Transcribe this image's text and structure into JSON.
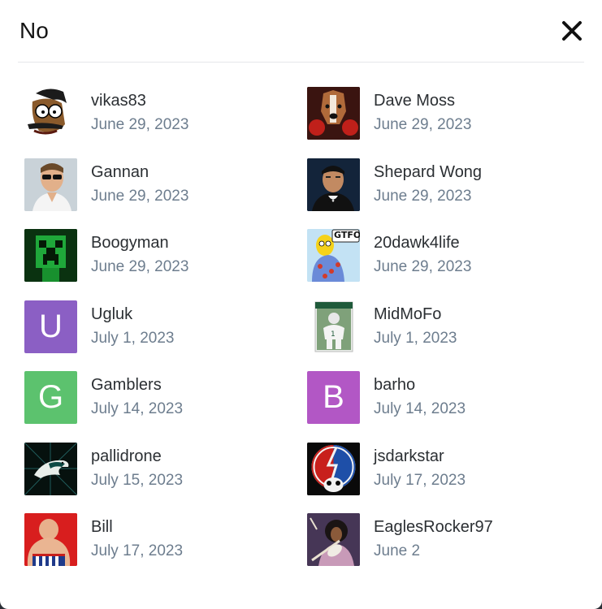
{
  "modal": {
    "title": "No",
    "close_icon": "close-icon"
  },
  "users": [
    {
      "name": "vikas83",
      "date": "June 29, 2023",
      "avatar": "cartoon-face-avatar"
    },
    {
      "name": "Dave Moss",
      "date": "June 29, 2023",
      "avatar": "boxer-dog-avatar"
    },
    {
      "name": "Gannan",
      "date": "June 29, 2023",
      "avatar": "sunglasses-man-avatar"
    },
    {
      "name": "Shepard Wong",
      "date": "June 29, 2023",
      "avatar": "bowtie-man-avatar"
    },
    {
      "name": "Boogyman",
      "date": "June 29, 2023",
      "avatar": "creeper-avatar"
    },
    {
      "name": "20dawk4life",
      "date": "June 29, 2023",
      "avatar": "gtfo-cartoon-avatar",
      "avatar_text": "GTFO"
    },
    {
      "name": "Ugluk",
      "date": "July 1, 2023",
      "avatar_letter": "U",
      "avatar_color": "#8b5fc4"
    },
    {
      "name": "MidMoFo",
      "date": "July 1, 2023",
      "avatar": "football-card-avatar"
    },
    {
      "name": "Gamblers",
      "date": "July 14, 2023",
      "avatar_letter": "G",
      "avatar_color": "#5cc26e"
    },
    {
      "name": "barho",
      "date": "July 14, 2023",
      "avatar_letter": "B",
      "avatar_color": "#b257c5"
    },
    {
      "name": "pallidrone",
      "date": "July 15, 2023",
      "avatar": "eagle-logo-avatar"
    },
    {
      "name": "jsdarkstar",
      "date": "July 17, 2023",
      "avatar": "steal-your-face-avatar"
    },
    {
      "name": "Bill",
      "date": "July 17, 2023",
      "avatar": "sumo-avatar"
    },
    {
      "name": "EaglesRocker97",
      "date": "June 2",
      "avatar": "guitarist-avatar"
    }
  ]
}
